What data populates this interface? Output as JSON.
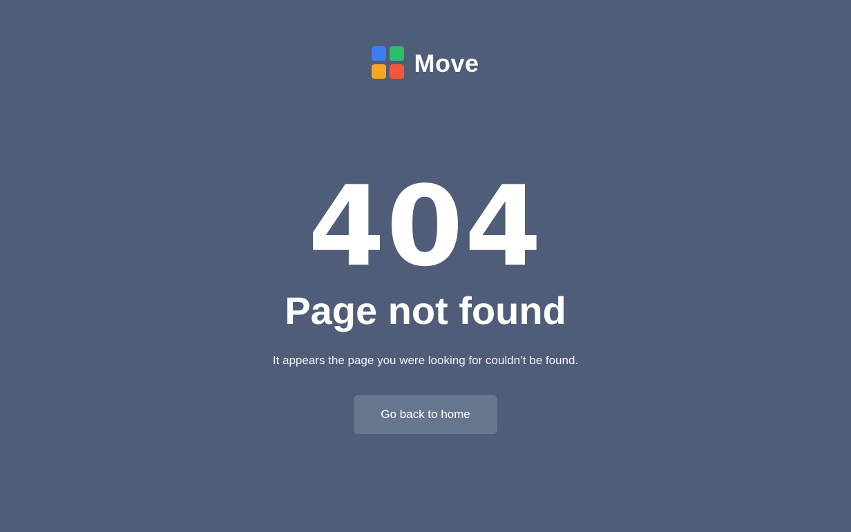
{
  "brand": {
    "name": "Move",
    "logo_colors": [
      "#3e7cf4",
      "#2fbd6e",
      "#f6a623",
      "#f2573a"
    ]
  },
  "error": {
    "code": "404",
    "title": "Page not found",
    "message": "It appears the page you were looking for couldn’t be found."
  },
  "actions": {
    "home_label": "Go back to home"
  },
  "colors": {
    "background": "#4f5d79",
    "button": "#67758f",
    "text": "#ffffff"
  }
}
